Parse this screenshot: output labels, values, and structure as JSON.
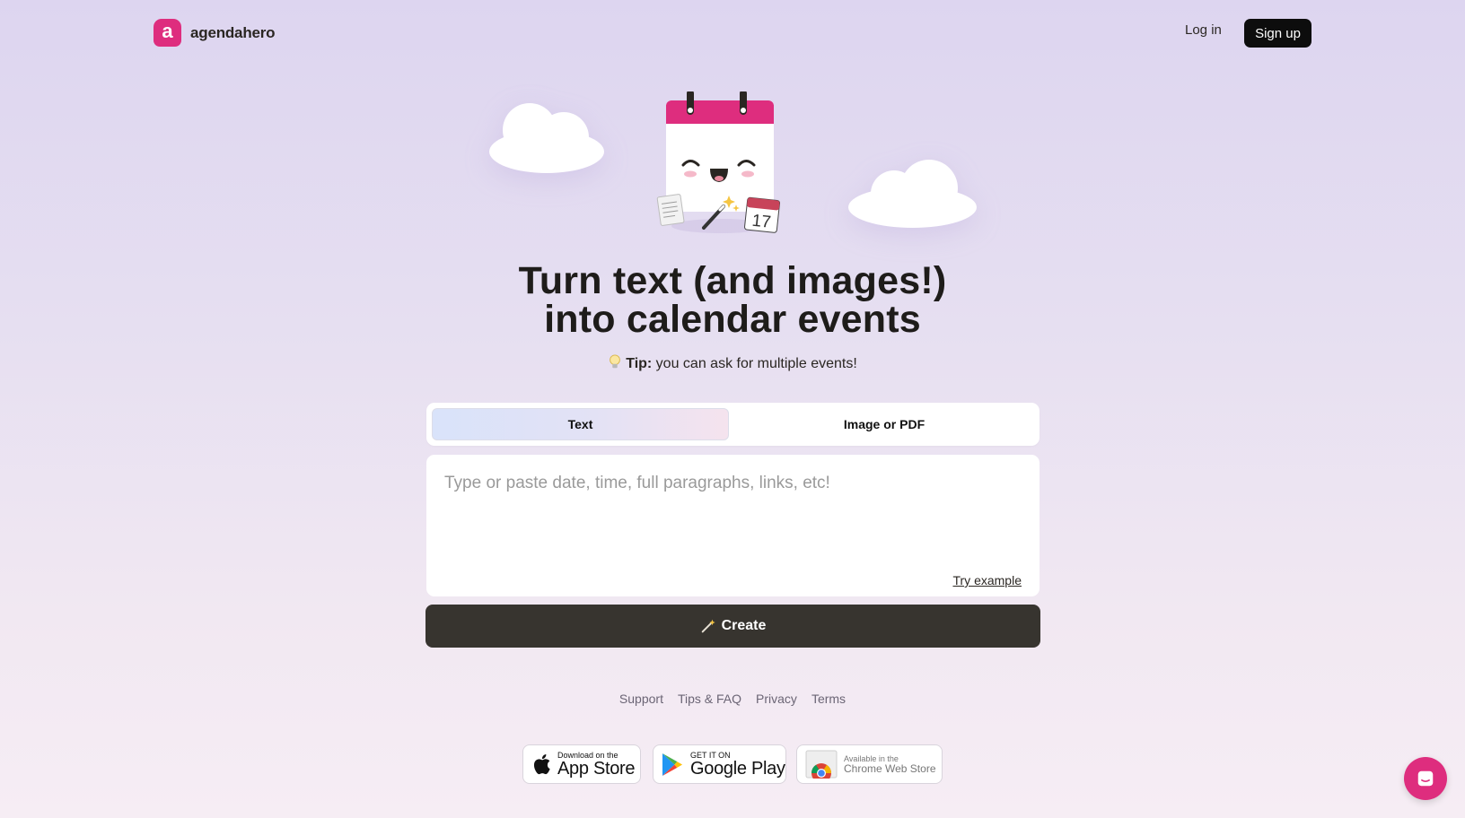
{
  "brand": {
    "logo_letter": "a",
    "name": "agendahero",
    "color": "#de2d7e"
  },
  "nav": {
    "login_label": "Log in",
    "signup_label": "Sign up"
  },
  "hero": {
    "headline_line1": "Turn text (and images!)",
    "headline_line2": "into calendar events",
    "tip_label": "Tip:",
    "tip_text": " you can ask for multiple events!",
    "calendar_date": "17"
  },
  "tabs": [
    {
      "label": "Text",
      "selected": true
    },
    {
      "label": "Image or PDF",
      "selected": false
    }
  ],
  "input": {
    "placeholder": "Type or paste date, time, full paragraphs, links, etc!",
    "value": "",
    "try_example_label": "Try example"
  },
  "create": {
    "label": "Create",
    "icon": "magic-wand-icon"
  },
  "footer": {
    "links": [
      "Support",
      "Tips & FAQ",
      "Privacy",
      "Terms"
    ]
  },
  "stores": {
    "apple": {
      "small": "Download on the",
      "big": "App Store"
    },
    "google": {
      "small": "GET IT ON",
      "big": "Google Play"
    },
    "chrome": {
      "small": "Available in the",
      "big": "Chrome Web Store"
    }
  },
  "colors": {
    "accent": "#de2d7e",
    "create_button": "#37342f",
    "signup_button": "#0d0d0d"
  }
}
